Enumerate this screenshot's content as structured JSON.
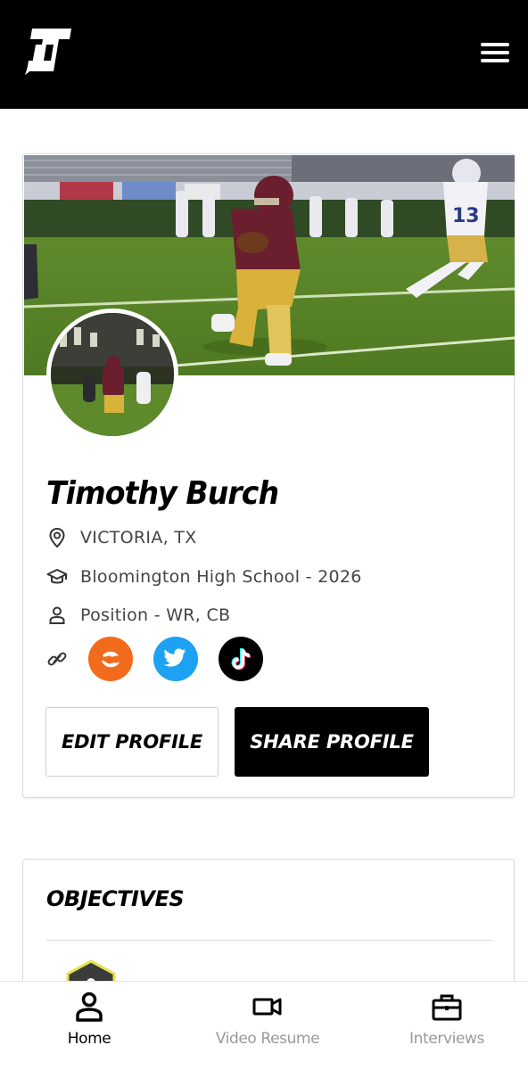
{
  "colors": {
    "topbar": "#000000",
    "accent_orange": "#f26a1b",
    "twitter_blue": "#1da1f2",
    "tiktok_black": "#000000",
    "muted_text": "#444444",
    "inactive_nav": "#9a9a9a"
  },
  "header": {
    "logo_icon": "brand-logo",
    "menu_icon": "hamburger-menu-icon"
  },
  "profile": {
    "name": "Timothy Burch",
    "location": "VICTORIA, TX",
    "school": "Bloomington High School - 2026",
    "position": "Position - WR, CB",
    "cover_image": "football-action-photo",
    "avatar_image": "football-avatar-photo",
    "socials": [
      {
        "name": "hudl",
        "icon": "hudl-icon"
      },
      {
        "name": "twitter",
        "icon": "twitter-icon"
      },
      {
        "name": "tiktok",
        "icon": "tiktok-icon"
      }
    ],
    "edit_label": "EDIT PROFILE",
    "share_label": "SHARE PROFILE"
  },
  "objectives": {
    "title": "OBJECTIVES"
  },
  "nav": {
    "items": [
      {
        "label": "Home",
        "icon": "person-icon",
        "active": true
      },
      {
        "label": "Video Resume",
        "icon": "video-camera-icon",
        "active": false
      },
      {
        "label": "Interviews",
        "icon": "briefcase-icon",
        "active": false
      }
    ]
  }
}
